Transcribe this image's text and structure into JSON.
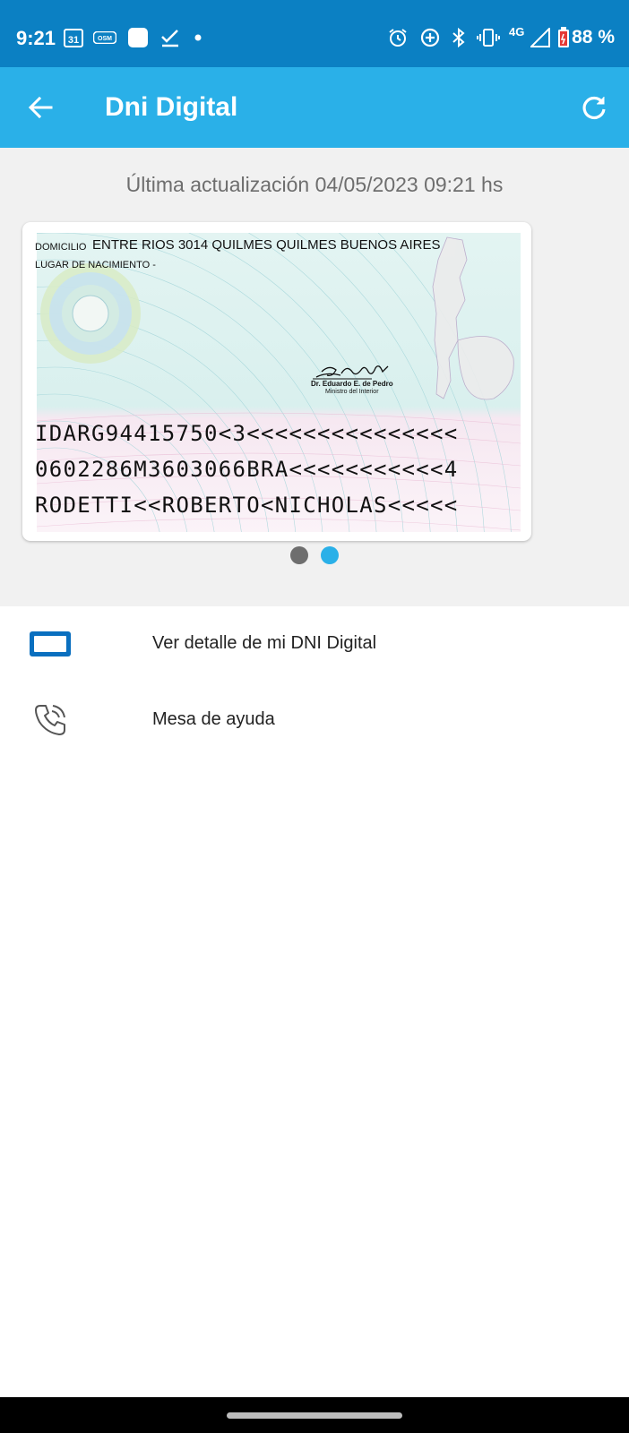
{
  "status_bar": {
    "time": "9:21",
    "calendar_day": "31",
    "osm_label": "OSM",
    "network": "4G",
    "battery": "88 %"
  },
  "app_bar": {
    "title": "Dni Digital"
  },
  "content": {
    "last_update": "Última actualización 04/05/2023 09:21 hs"
  },
  "card": {
    "domicilio_label": "DOMICILIO",
    "domicilio_value": "ENTRE RIOS 3014 QUILMES QUILMES BUENOS AIRES",
    "lugar_label": "LUGAR DE NACIMIENTO -",
    "signer_name": "Dr. Eduardo E. de Pedro",
    "signer_role": "Ministro del Interior",
    "mrz_line1": "IDARG94415750<3<<<<<<<<<<<<<<<",
    "mrz_line2": "0602286M3603066BRA<<<<<<<<<<<4",
    "mrz_line3": "RODETTI<<ROBERTO<NICHOLAS<<<<<"
  },
  "pager": {
    "pages": 2,
    "active_index": 1
  },
  "menu": [
    {
      "label": "Ver detalle de mi DNI Digital",
      "icon": "id-card-icon"
    },
    {
      "label": "Mesa de ayuda",
      "icon": "phone-call-icon"
    }
  ],
  "colors": {
    "status_bar": "#0b80c3",
    "app_bar": "#2ab0e8",
    "accent": "#2ab0e8",
    "icon_blue": "#0a6fbf"
  }
}
